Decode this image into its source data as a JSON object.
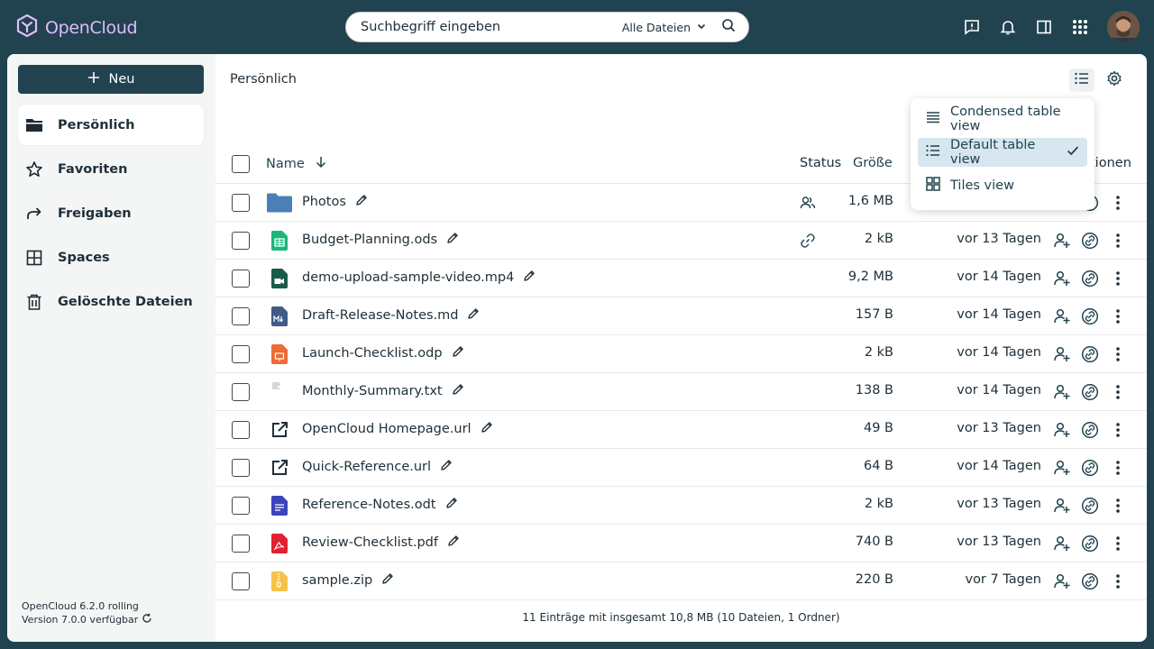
{
  "app": {
    "name": "OpenCloud",
    "brand_color": "#e2baff"
  },
  "search": {
    "placeholder": "Suchbegriff eingeben",
    "filter_label": "Alle Dateien"
  },
  "topbar_icons": [
    "feedback-icon",
    "bell-icon",
    "sidebar-panel-icon",
    "apps-grid-icon"
  ],
  "sidebar": {
    "new_label": "Neu",
    "items": [
      {
        "label": "Persönlich",
        "icon": "folder-icon",
        "active": true
      },
      {
        "label": "Favoriten",
        "icon": "star-icon",
        "active": false
      },
      {
        "label": "Freigaben",
        "icon": "share-icon",
        "active": false
      },
      {
        "label": "Spaces",
        "icon": "spaces-icon",
        "active": false
      },
      {
        "label": "Gelöschte Dateien",
        "icon": "trash-icon",
        "active": false
      }
    ],
    "version_line1": "OpenCloud 6.2.0 rolling",
    "version_line2": "Version 7.0.0 verfügbar"
  },
  "main": {
    "breadcrumb": "Persönlich",
    "columns": {
      "name": "Name",
      "status": "Status",
      "size": "Größe",
      "actions": "tionen"
    },
    "footer": "11 Einträge mit insgesamt 10,8 MB (10 Dateien, 1 Ordner)"
  },
  "files": [
    {
      "name": "Photos",
      "type": "folder",
      "status": "shared-users",
      "size": "1,6 MB",
      "modified": ""
    },
    {
      "name": "Budget-Planning.ods",
      "type": "spreadsheet",
      "status": "link",
      "size": "2 kB",
      "modified": "vor 13 Tagen"
    },
    {
      "name": "demo-upload-sample-video.mp4",
      "type": "video",
      "status": "",
      "size": "9,2 MB",
      "modified": "vor 14 Tagen"
    },
    {
      "name": "Draft-Release-Notes.md",
      "type": "markdown",
      "status": "",
      "size": "157 B",
      "modified": "vor 14 Tagen"
    },
    {
      "name": "Launch-Checklist.odp",
      "type": "presentation",
      "status": "",
      "size": "2 kB",
      "modified": "vor 14 Tagen"
    },
    {
      "name": "Monthly-Summary.txt",
      "type": "text",
      "status": "",
      "size": "138 B",
      "modified": "vor 14 Tagen"
    },
    {
      "name": "OpenCloud Homepage.url",
      "type": "url",
      "status": "",
      "size": "49 B",
      "modified": "vor 13 Tagen"
    },
    {
      "name": "Quick-Reference.url",
      "type": "url",
      "status": "",
      "size": "64 B",
      "modified": "vor 14 Tagen"
    },
    {
      "name": "Reference-Notes.odt",
      "type": "document",
      "status": "",
      "size": "2 kB",
      "modified": "vor 13 Tagen"
    },
    {
      "name": "Review-Checklist.pdf",
      "type": "pdf",
      "status": "",
      "size": "740 B",
      "modified": "vor 13 Tagen"
    },
    {
      "name": "sample.zip",
      "type": "archive",
      "status": "",
      "size": "220 B",
      "modified": "vor 7 Tagen"
    }
  ],
  "view_menu": {
    "items": [
      {
        "label": "Condensed table view",
        "icon": "condensed-list-icon",
        "selected": false
      },
      {
        "label": "Default table view",
        "icon": "list-icon",
        "selected": true
      },
      {
        "label": "Tiles view",
        "icon": "tiles-icon",
        "selected": false
      }
    ]
  },
  "colors": {
    "header_bg": "#20434f",
    "accent": "#20434f",
    "selected_bg": "#d7e6ef"
  }
}
